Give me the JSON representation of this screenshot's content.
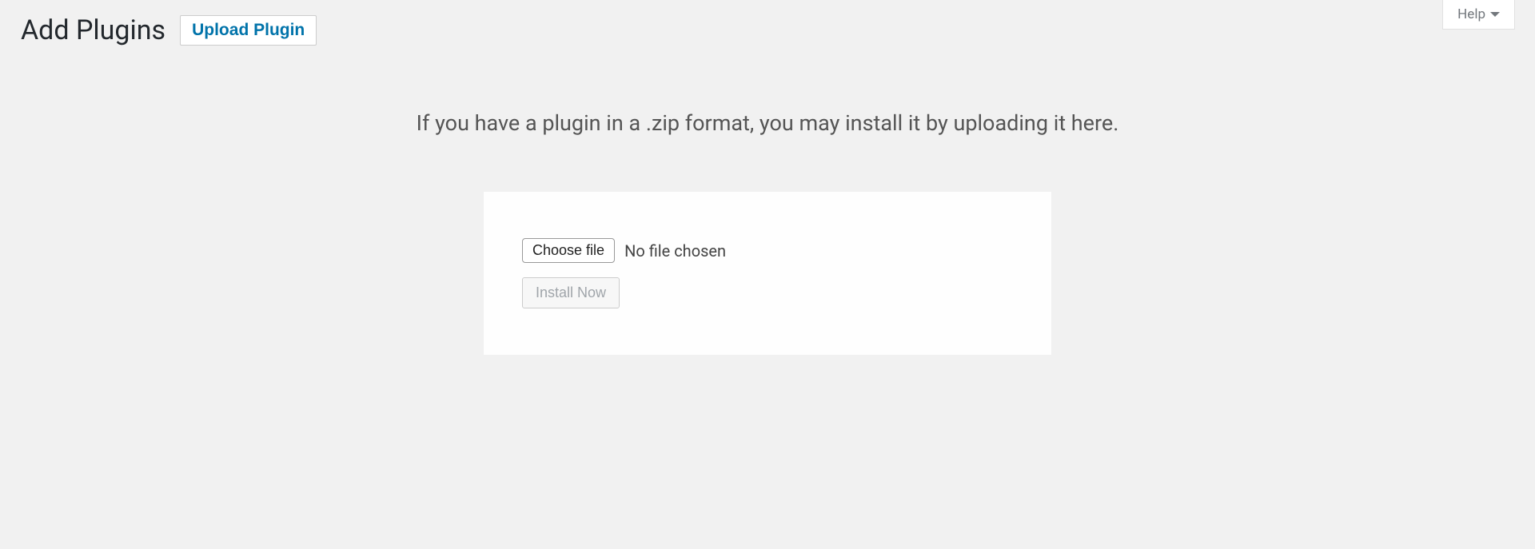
{
  "help": {
    "label": "Help"
  },
  "header": {
    "title": "Add Plugins",
    "upload_button": "Upload Plugin"
  },
  "upload": {
    "description": "If you have a plugin in a .zip format, you may install it by uploading it here.",
    "choose_file_label": "Choose file",
    "no_file_text": "No file chosen",
    "install_button": "Install Now"
  }
}
